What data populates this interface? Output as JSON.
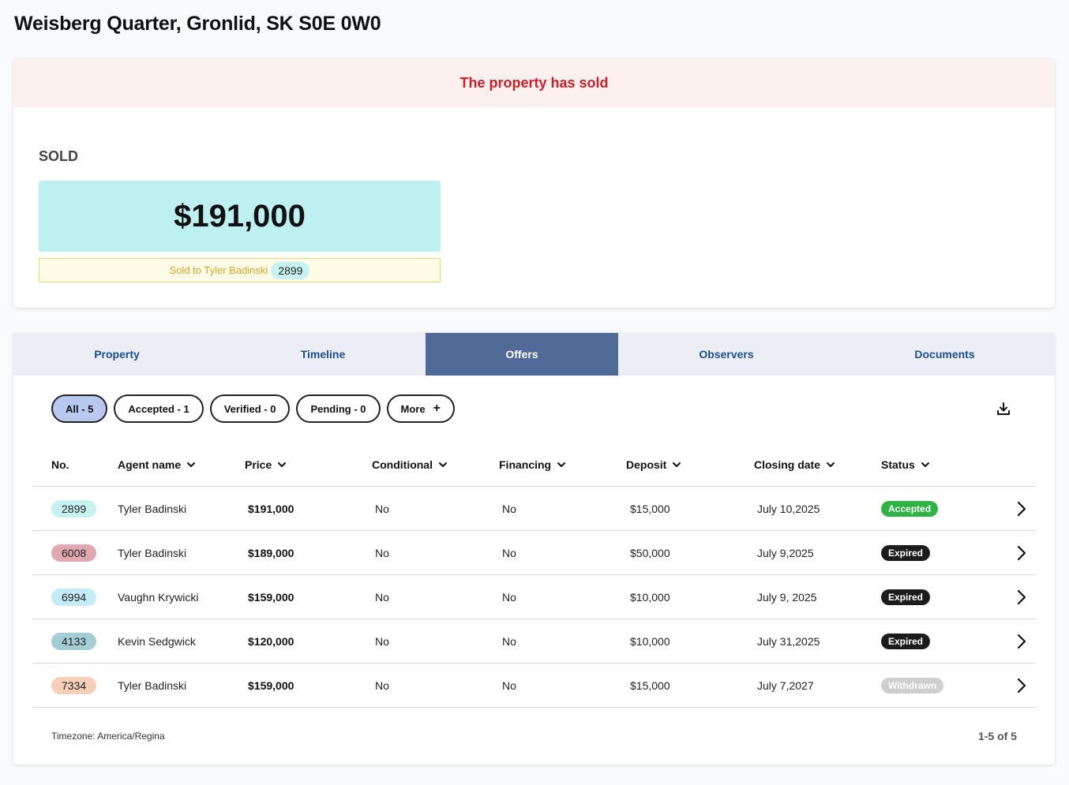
{
  "page": {
    "title": "Weisberg Quarter, Gronlid, SK S0E 0W0"
  },
  "summary": {
    "banner": "The property has sold",
    "status_label": "SOLD",
    "price": "$191,000",
    "sold_to_text": "Sold to Tyler Badinski",
    "sold_to_offer": "2899"
  },
  "tabs": [
    {
      "label": "Property"
    },
    {
      "label": "Timeline"
    },
    {
      "label": "Offers",
      "active": true
    },
    {
      "label": "Observers"
    },
    {
      "label": "Documents"
    }
  ],
  "filters": [
    {
      "label": "All - 5",
      "active": true
    },
    {
      "label": "Accepted - 1"
    },
    {
      "label": "Verified - 0"
    },
    {
      "label": "Pending - 0"
    },
    {
      "label": "More",
      "icon": "plus-icon"
    }
  ],
  "table": {
    "columns": [
      "No.",
      "Agent name",
      "Price",
      "Conditional",
      "Financing",
      "Deposit",
      "Closing date",
      "Status"
    ],
    "rows": [
      {
        "no": "2899",
        "no_color": "#c7f2f2",
        "agent": "Tyler Badinski",
        "price": "$191,000",
        "conditional": "No",
        "financing": "No",
        "deposit": "$15,000",
        "closing": "July 10,2025",
        "status": "Accepted",
        "status_bg": "#2fb344",
        "status_fg": "#ffffff"
      },
      {
        "no": "6008",
        "no_color": "#e0a9b1",
        "agent": "Tyler Badinski",
        "price": "$189,000",
        "conditional": "No",
        "financing": "No",
        "deposit": "$50,000",
        "closing": "July 9,2025",
        "status": "Expired",
        "status_bg": "#1c1c1c",
        "status_fg": "#ffffff"
      },
      {
        "no": "6994",
        "no_color": "#c3ecf7",
        "agent": "Vaughn Krywicki",
        "price": "$159,000",
        "conditional": "No",
        "financing": "No",
        "deposit": "$10,000",
        "closing": "July 9, 2025",
        "status": "Expired",
        "status_bg": "#1c1c1c",
        "status_fg": "#ffffff"
      },
      {
        "no": "4133",
        "no_color": "#a5cdd6",
        "agent": "Kevin Sedgwick",
        "price": "$120,000",
        "conditional": "No",
        "financing": "No",
        "deposit": "$10,000",
        "closing": "July 31,2025",
        "status": "Expired",
        "status_bg": "#1c1c1c",
        "status_fg": "#ffffff"
      },
      {
        "no": "7334",
        "no_color": "#f6cfb9",
        "agent": "Tyler Badinski",
        "price": "$159,000",
        "conditional": "No",
        "financing": "No",
        "deposit": "$15,000",
        "closing": "July 7,2027",
        "status": "Withdrawn",
        "status_bg": "#cfcfcf",
        "status_fg": "#ffffff"
      }
    ]
  },
  "footer": {
    "timezone": "Timezone: America/Regina",
    "pagination": "1-5 of 5"
  },
  "colors": {
    "sold_banner_bg": "#fdf1ef",
    "sold_banner_text": "#c8202a",
    "price_bg": "#bff0f0",
    "active_tab": "#506a98",
    "tab_text": "#1e4e8c",
    "active_filter": "#b9c8ee"
  }
}
